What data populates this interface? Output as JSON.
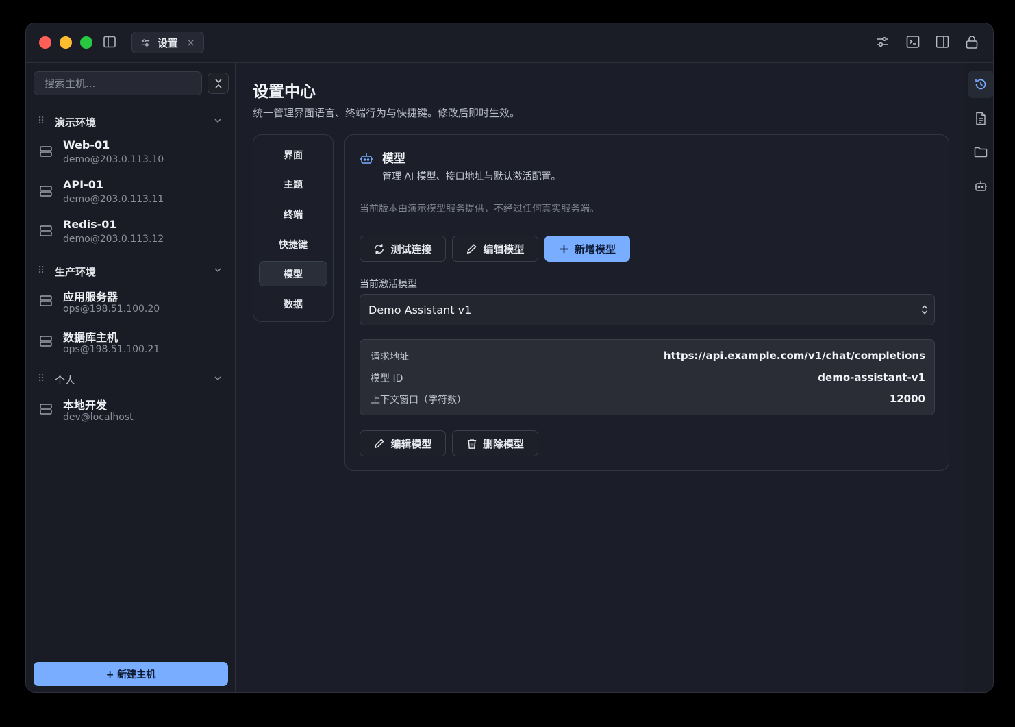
{
  "titlebar": {
    "tab_label": "设置",
    "tab_close": "×",
    "icons": [
      "sidebar-toggle-icon",
      "settings-sliders-icon",
      "terminal-icon",
      "split-panel-icon",
      "lock-icon"
    ]
  },
  "sidebar": {
    "search_placeholder": "搜索主机...",
    "groups": [
      {
        "title": "演示环境",
        "hosts": [
          {
            "name": "Web-01",
            "addr": "demo@203.0.113.10"
          },
          {
            "name": "API-01",
            "addr": "demo@203.0.113.11"
          },
          {
            "name": "Redis-01",
            "addr": "demo@203.0.113.12"
          }
        ]
      },
      {
        "title": "生产环境",
        "hosts": [
          {
            "name": "应用服务器",
            "addr": "ops@198.51.100.20"
          },
          {
            "name": "数据库主机",
            "addr": "ops@198.51.100.21"
          }
        ]
      },
      {
        "title": "个人",
        "hosts": [
          {
            "name": "本地开发",
            "addr": "dev@localhost"
          }
        ]
      }
    ],
    "new_host_label": "+ 新建主机"
  },
  "main": {
    "title": "设置中心",
    "subtitle": "统一管理界面语言、终端行为与快捷键。修改后即时生效。",
    "nav": [
      "界面",
      "主题",
      "终端",
      "快捷键",
      "模型",
      "数据"
    ],
    "active_nav": "模型",
    "card": {
      "title": "模型",
      "subtitle": "管理 AI 模型、接口地址与默认激活配置。",
      "note": "当前版本由演示模型服务提供，不经过任何真实服务端。",
      "buttons": {
        "test": "测试连接",
        "edit": "编辑模型",
        "add": "新增模型",
        "edit2": "编辑模型",
        "delete": "删除模型"
      },
      "active_label": "当前激活模型",
      "active_model": "Demo Assistant v1",
      "info": [
        {
          "key": "请求地址",
          "value": "https://api.example.com/v1/chat/completions"
        },
        {
          "key": "模型 ID",
          "value": "demo-assistant-v1"
        },
        {
          "key": "上下文窗口（字符数）",
          "value": "12000"
        }
      ]
    }
  },
  "rail": {
    "icons": [
      "history-icon",
      "document-icon",
      "folder-icon",
      "robot-icon"
    ]
  },
  "colors": {
    "accent": "#79adff",
    "background": "#1b1e28",
    "traffic_red": "#ff5f57",
    "traffic_yellow": "#febc2e",
    "traffic_green": "#28c840"
  }
}
